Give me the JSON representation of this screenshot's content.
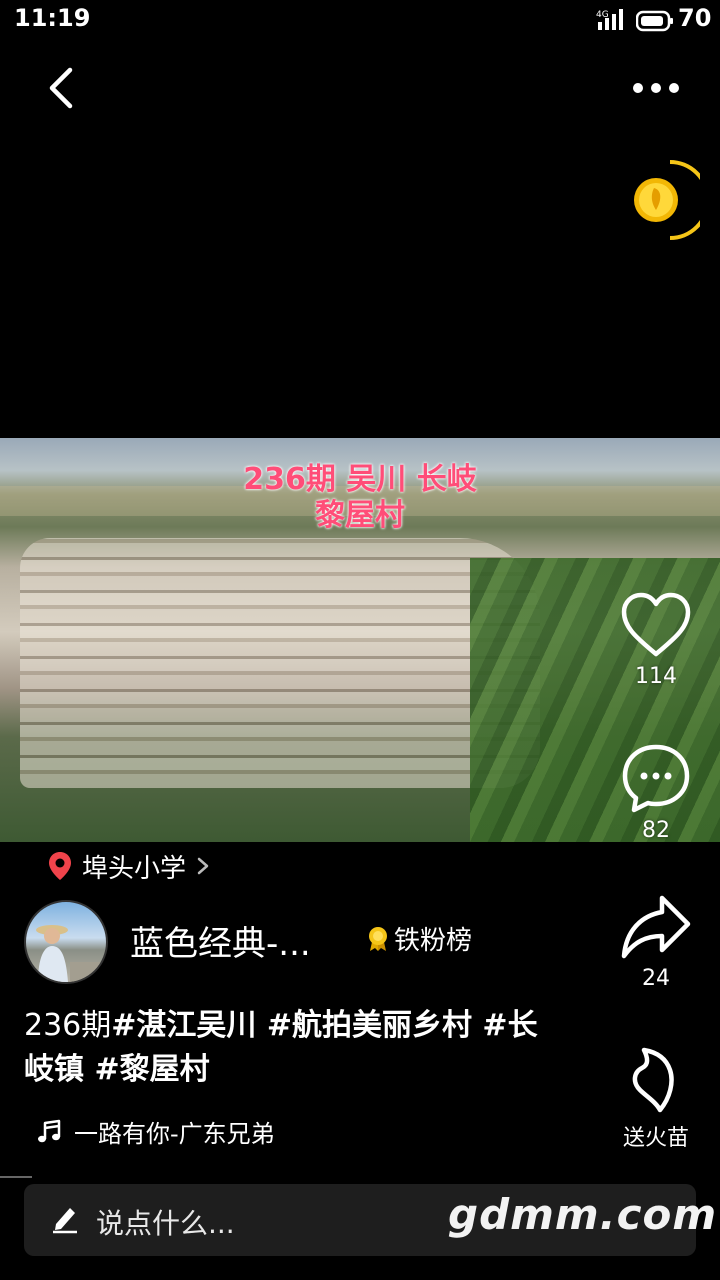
{
  "status_bar": {
    "time": "11:19",
    "network": "4G",
    "battery": "70"
  },
  "nav": {
    "back_icon": "chevron-left-icon",
    "more_icon": "more-dots-icon"
  },
  "coin": {
    "icon": "gold-coin-icon",
    "accent": "#f5c518"
  },
  "video": {
    "caption_line1": "236期 吴川 长岐",
    "caption_line2": "黎屋村",
    "caption_color": "#ff4d78"
  },
  "actions": {
    "like_count": "114",
    "comment_count": "82",
    "share_count": "24",
    "gift_label": "送火苗"
  },
  "location": {
    "label": "埠头小学"
  },
  "author": {
    "name": "蓝色经典-...",
    "badge": "铁粉榜"
  },
  "description": {
    "prefix": "236期",
    "tags_line1": "#湛江吴川 #航拍美丽乡村 #长",
    "tags_line2": "岐镇 #黎屋村"
  },
  "music": {
    "title": "一路有你-广东兄弟"
  },
  "comment_bar": {
    "placeholder": "说点什么..."
  },
  "watermark": "gdmm.com"
}
